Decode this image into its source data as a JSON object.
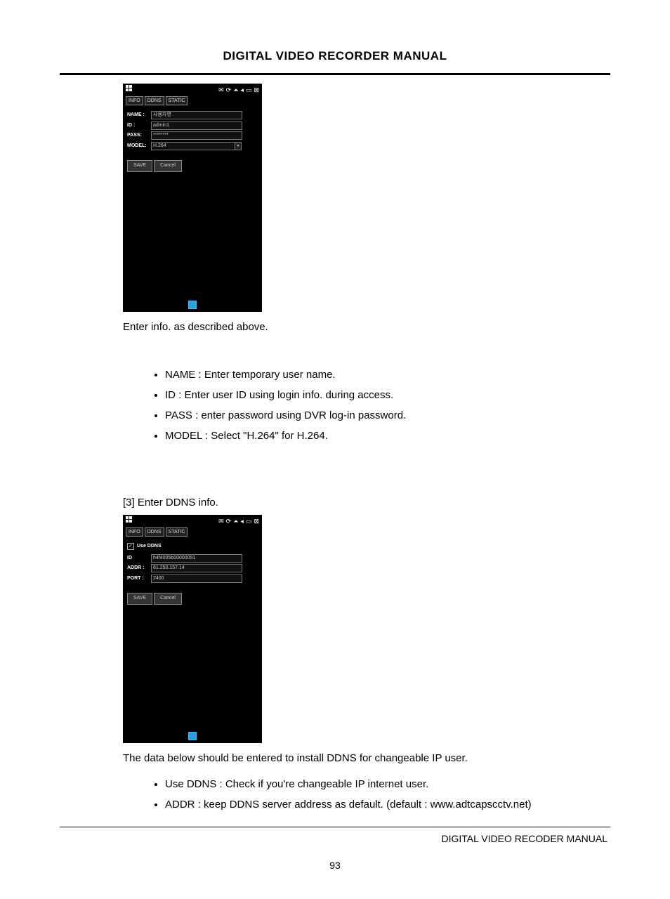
{
  "header": {
    "title": "DIGITAL VIDEO RECORDER MANUAL"
  },
  "footer": {
    "right": "DIGITAL VIDEO RECODER MANUAL",
    "page": "93"
  },
  "shot1": {
    "tabs": [
      "INFO",
      "DDNS",
      "STATIC"
    ],
    "fields": {
      "name_label": "NAME :",
      "name_value": "사용자명",
      "id_label": "ID :",
      "id_value": "admin1",
      "pass_label": "PASS:",
      "pass_value": "********",
      "model_label": "MODEL:",
      "model_value": "H.264"
    },
    "buttons": {
      "save": "SAVE",
      "cancel": "Cancel"
    }
  },
  "section1": {
    "intro": "Enter info. as described above.",
    "bullets": [
      "NAME : Enter temporary user name.",
      "ID : Enter user ID using login info. during access.",
      "PASS : enter password using DVR log-in password.",
      "MODEL : Select \"H.264\" for H.264."
    ]
  },
  "step3": "[3] Enter DDNS info.",
  "shot2": {
    "tabs": [
      "INFO",
      "DDNS",
      "STATIC"
    ],
    "checkbox": {
      "mark": "✓",
      "label": "Use DDNS"
    },
    "fields": {
      "id_label": "ID",
      "id_value": "h4f4005b00000091",
      "addr_label": "ADDR :",
      "addr_value": "61.250.157.14",
      "port_label": "PORT :",
      "port_value": "2400"
    },
    "buttons": {
      "save": "SAVE",
      "cancel": "Cancel"
    }
  },
  "section2": {
    "intro": "The data below should be entered to install DDNS for changeable IP user.",
    "bullets": [
      "Use DDNS   : Check if you're changeable IP internet user.",
      "ADDR : keep DDNS server address as default. (default : www.adtcapscctv.net)"
    ]
  }
}
